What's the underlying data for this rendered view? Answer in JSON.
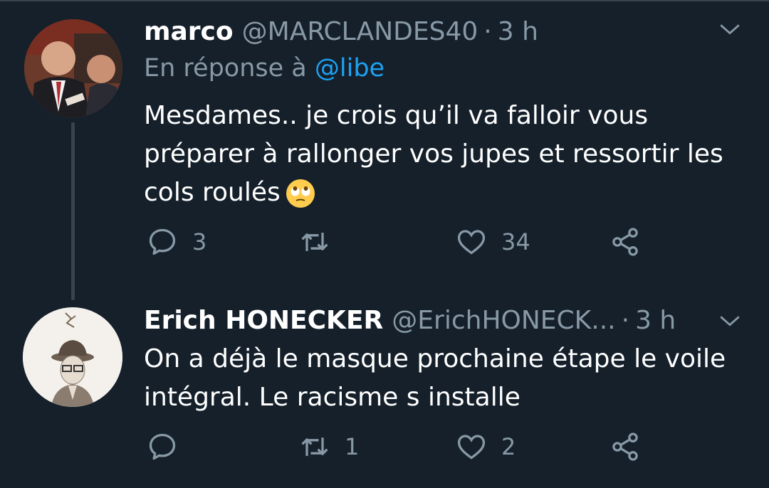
{
  "tweets": [
    {
      "display_name": "marco",
      "handle": "@MARCLANDES40",
      "separator": "·",
      "time": "3 h",
      "reply_prefix": "En réponse à",
      "reply_mention": "@libe",
      "text": "Mesdames.. je crois qu’il va falloir vous préparer à rallonger vos jupes et ressortir les cols roulés",
      "emoji": "face-with-rolling-eyes",
      "replies": "3",
      "retweets": "",
      "likes": "34"
    },
    {
      "display_name": "Erich HONECKER",
      "handle": "@ErichHONECK...",
      "separator": "·",
      "time": "3 h",
      "text": "On a déjà le masque prochaine étape le voile intégral. Le racisme s installe",
      "replies": "",
      "retweets": "1",
      "likes": "2"
    }
  ],
  "colors": {
    "background": "#15202b",
    "text": "#ffffff",
    "muted": "#8899a6",
    "link": "#1da1f2",
    "divider": "#38444d"
  },
  "icons": [
    "reply-icon",
    "retweet-icon",
    "like-icon",
    "share-icon",
    "chevron-down-icon"
  ]
}
